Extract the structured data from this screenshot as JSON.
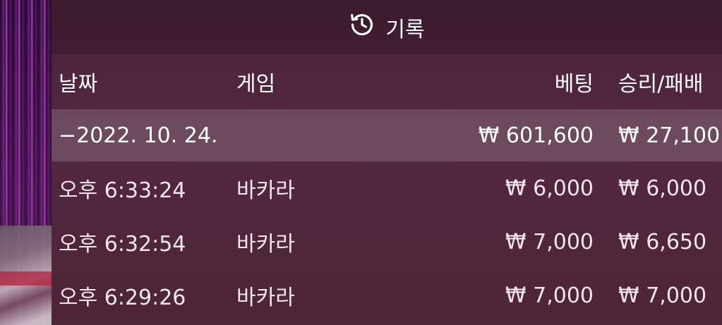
{
  "header": {
    "title": "기록",
    "icon": "history-icon"
  },
  "columns": {
    "date": "날짜",
    "game": "게임",
    "bet": "베팅",
    "result": "승리/패배"
  },
  "summary": {
    "date": "−2022. 10. 24.",
    "bet": "₩ 601,600",
    "result": "₩ 27,100"
  },
  "rows": [
    {
      "time": "오후 6:33:24",
      "game": "바카라",
      "bet": "₩ 6,000",
      "result": "₩ 6,000"
    },
    {
      "time": "오후 6:32:54",
      "game": "바카라",
      "bet": "₩ 7,000",
      "result": "₩ 6,650"
    },
    {
      "time": "오후 6:29:26",
      "game": "바카라",
      "bet": "₩ 7,000",
      "result": "₩ 7,000"
    }
  ],
  "colors": {
    "panel_bg": "#4e2537",
    "summary_bg": "rgba(255,255,255,0.16)",
    "text": "#ffffff"
  }
}
